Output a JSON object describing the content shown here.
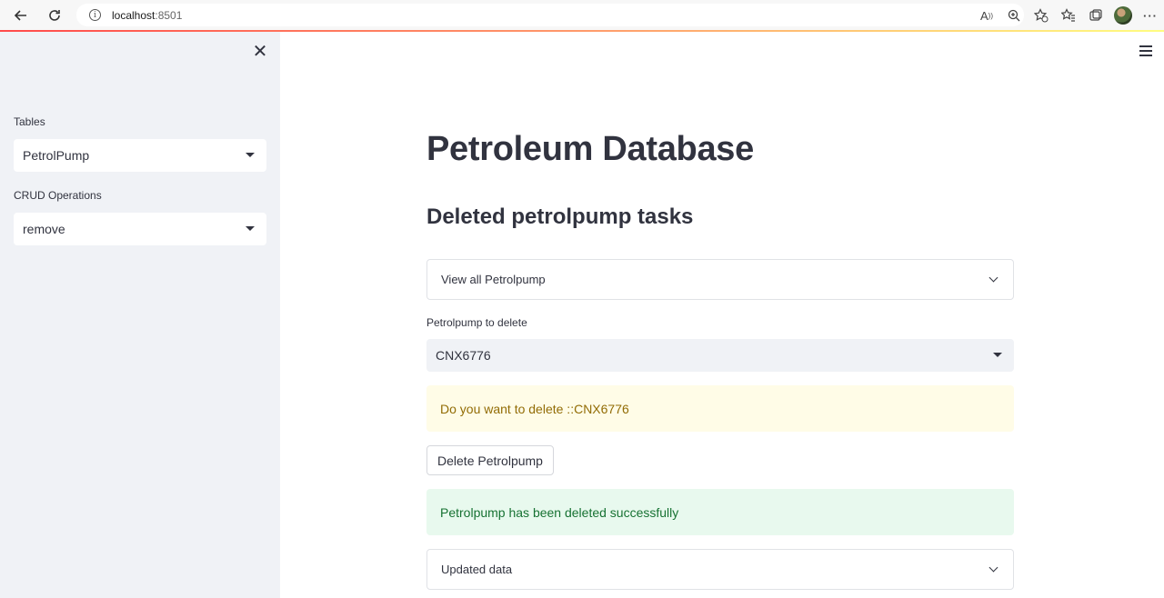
{
  "browser": {
    "url_host": "localhost",
    "url_port": ":8501"
  },
  "sidebar": {
    "tables_label": "Tables",
    "tables_value": "PetrolPump",
    "crud_label": "CRUD Operations",
    "crud_value": "remove"
  },
  "main": {
    "title": "Petroleum Database",
    "subtitle": "Deleted petrolpump tasks",
    "view_all_expander": "View all Petrolpump",
    "delete_select_label": "Petrolpump to delete",
    "delete_select_value": "CNX6776",
    "warning_text": "Do you want to delete ::CNX6776",
    "delete_button": "Delete Petrolpump",
    "success_text": "Petrolpump has been deleted successfully",
    "updated_expander": "Updated data"
  },
  "colors": {
    "sidebar_bg": "#f0f2f6",
    "warning_bg": "#fffce7",
    "warning_text": "#926c05",
    "success_bg": "#e8f9ee",
    "success_text": "#177233",
    "text": "#31333f"
  }
}
